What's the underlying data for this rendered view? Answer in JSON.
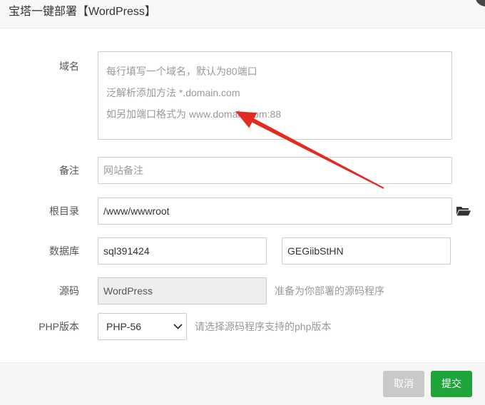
{
  "dialog": {
    "title": "宝塔一键部署【WordPress】"
  },
  "form": {
    "domain": {
      "label": "域名",
      "placeholder": "每行填写一个域名，默认为80端口\n泛解析添加方法 *.domain.com\n如另加端口格式为 www.domain.com:88"
    },
    "remark": {
      "label": "备注",
      "placeholder": "网站备注"
    },
    "root": {
      "label": "根目录",
      "value": "/www/wwwroot"
    },
    "database": {
      "label": "数据库",
      "name": "sql391424",
      "password": "GEGiibStHN"
    },
    "source": {
      "label": "源码",
      "value": "WordPress",
      "hint": "准备为你部署的源码程序"
    },
    "php": {
      "label": "PHP版本",
      "selected": "PHP-56",
      "hint": "请选择源码程序支持的php版本"
    }
  },
  "footer": {
    "cancel_label": "取消",
    "submit_label": "提交"
  },
  "icons": {
    "close": "close-icon",
    "folder": "folder-open-icon",
    "select_arrow": "chevron-down-icon"
  },
  "colors": {
    "accent": "#20a53a",
    "cancel": "#c9c9c9",
    "annotation": "#e42b22",
    "title_bar": "#f8f8f8",
    "footer": "#f6f6f6"
  }
}
